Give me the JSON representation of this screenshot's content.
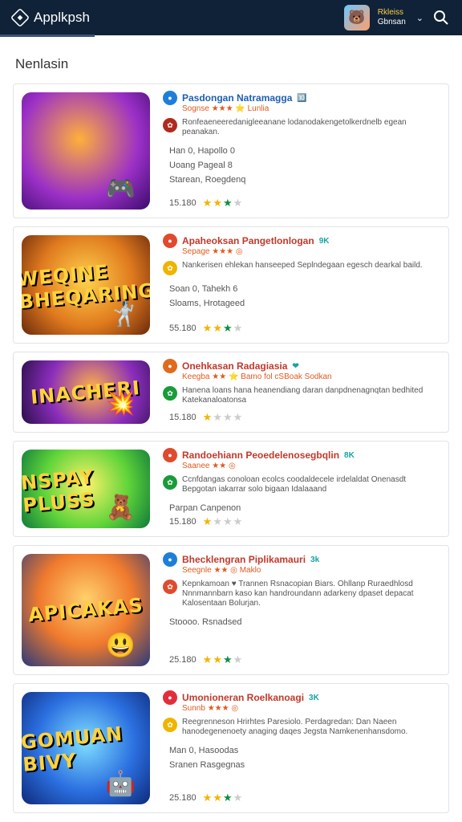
{
  "app": {
    "name": "Applkpsh"
  },
  "user": {
    "name_line1": "Rkleiss",
    "name_line2": "Gbnsan"
  },
  "page_title": "Nenlasin",
  "cards": [
    {
      "name": "Pasdongan Natramagga",
      "badge": "🔟",
      "sub": "Sognse ★★★ ⭐ Lunlia",
      "desc": "Ronfeaeneeredanigleeanane lodanodakengetolkerdnelb egean peanakan.",
      "meta1": "Han 0, Hapollo 0",
      "meta2": "Uoang Pageal 8",
      "meta3": "Starean, Roegdenq",
      "count": "15.180",
      "stars": [
        "1",
        "1",
        "2",
        "3"
      ],
      "thumb_text": "",
      "thumb_emoji": "🎮"
    },
    {
      "name": "Apaheoksan Pangetlonlogan",
      "badge": "9K",
      "sub": "Sepage ★★★ ◎",
      "desc": "Nankerisen ehlekan hanseeped Seplndegaan egesch dearkal baild.",
      "meta1": "Soan 0, Tahekh 6",
      "meta2": "Sloams, Hrotageed",
      "meta3": "",
      "count": "55.180",
      "stars": [
        "1",
        "1",
        "2",
        "3"
      ],
      "thumb_text": "WEQINE BHEQARING",
      "thumb_emoji": "🤺"
    },
    {
      "name": "Onehkasan Radagiasia",
      "badge": "❤",
      "sub": "Keegba ★★ ⭐ Bamo fol cSBoak Sodkan",
      "desc": "Hanena loans hana heanendiang daran danpdnenagnqtan bedhited Katekanaloatonsa",
      "meta1": "",
      "meta2": "",
      "meta3": "",
      "count": "15.180",
      "stars": [
        "1",
        "3",
        "3",
        "3"
      ],
      "thumb_text": "INACHERI",
      "thumb_emoji": "💥"
    },
    {
      "name": "Randoehiann Peoedelenosegbqlin",
      "badge": "8K",
      "sub": "Saanee ★★ ◎",
      "desc": "Ccnfdangas conoloan ecolcs coodaldecele irdelaldat Onenasdt Bepgotan iakarrar solo bigaan Idalaaand",
      "meta1": "Parpan Canpenon",
      "meta2": "",
      "meta3": "",
      "count": "15.180",
      "stars": [
        "1",
        "3",
        "3",
        "3"
      ],
      "thumb_text": "NSPAY PLUSS",
      "thumb_emoji": "🧸"
    },
    {
      "name": "Bhecklengran Piplikamauri",
      "badge": "3k",
      "sub": "Seegnle ★★ ◎ Maklo",
      "desc": "Kepnkamoan ♥ Trannen Rsnacopian Biars. Ohllanp Ruraedhlosd Nnnmannbarn kaso kan handroundann adarkeny dpaset depacat Kalosentaan Bolurjan.",
      "meta1": "Stoooo. Rsnadsed",
      "meta2": "",
      "meta3": "",
      "count": "25.180",
      "stars": [
        "1",
        "1",
        "2",
        "3"
      ],
      "thumb_text": "APICAKAS",
      "thumb_emoji": "😃"
    },
    {
      "name": "Umonioneran Roelkanoagi",
      "badge": "3K",
      "sub": "Sunnb ★★★ ◎",
      "desc": "Reegrenneson Hrirhtes Paresiolo. Perdagredan: Dan Naeen hanodegenenoety anaging daqes Jegsta Namkenenhansdomo.",
      "meta1": "Man 0, Hasoodas",
      "meta2": "Sranen Rasgegnas",
      "meta3": "",
      "count": "25.180",
      "stars": [
        "1",
        "1",
        "2",
        "3"
      ],
      "thumb_text": "GOMUAN BIVY",
      "thumb_emoji": "🤖"
    }
  ]
}
